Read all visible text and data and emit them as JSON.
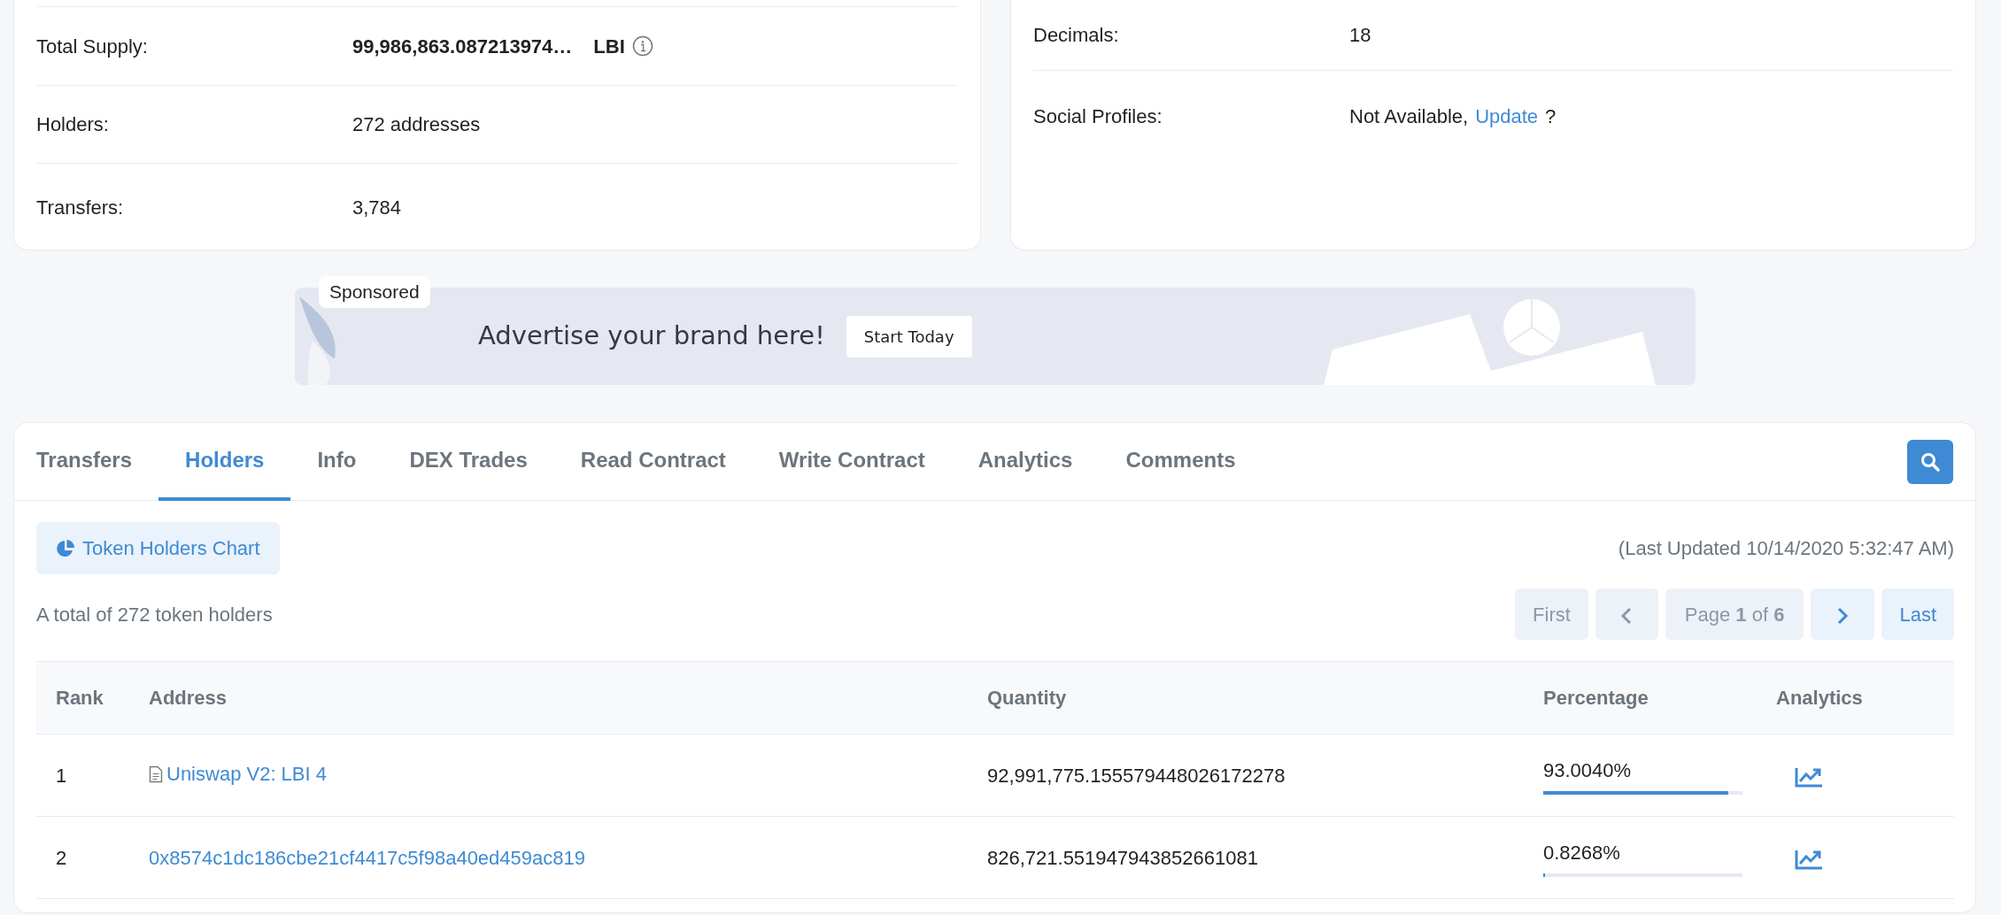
{
  "token_overview": {
    "rows": [
      {
        "label": "Total Supply:",
        "kind": "supply",
        "value": "99,986,863.087213974…",
        "unit": "LBI"
      },
      {
        "label": "Holders:",
        "kind": "text",
        "value": "272 addresses"
      },
      {
        "label": "Transfers:",
        "kind": "text",
        "value": "3,784"
      }
    ]
  },
  "profile_summary": {
    "rows": [
      {
        "label": "Decimals:",
        "kind": "text",
        "value": "18"
      },
      {
        "label": "Social Profiles:",
        "kind": "link",
        "value": "Not Available,",
        "link": "Update",
        "suffix": "?"
      }
    ]
  },
  "sponsored_banner": {
    "badge": "Sponsored",
    "headline": "Advertise your brand here!",
    "button": "Start Today"
  },
  "tabs": [
    {
      "label": "Transfers",
      "selected": false
    },
    {
      "label": "Holders",
      "selected": true
    },
    {
      "label": "Info",
      "selected": false
    },
    {
      "label": "DEX Trades",
      "selected": false
    },
    {
      "label": "Read Contract",
      "selected": false
    },
    {
      "label": "Write Contract",
      "selected": false
    },
    {
      "label": "Analytics",
      "selected": false
    },
    {
      "label": "Comments",
      "selected": false
    }
  ],
  "holders_panel": {
    "chart_button": "Token Holders Chart",
    "last_updated": "(Last Updated 10/14/2020 5:32:47 AM)",
    "total_text": "A total of 272 token holders",
    "pagination": [
      {
        "kind": "first",
        "label": "First",
        "disabled": true
      },
      {
        "kind": "prev",
        "disabled": true
      },
      {
        "kind": "page",
        "label": "Page **1** of **6**",
        "disabled": true
      },
      {
        "kind": "next",
        "disabled": false
      },
      {
        "kind": "last",
        "label": "Last",
        "disabled": false
      }
    ]
  },
  "table": {
    "columns": [
      "Rank",
      "Address",
      "Quantity",
      "Percentage",
      "Analytics"
    ],
    "rows": [
      {
        "rank": "1",
        "address": "Uniswap V2: LBI 4",
        "contract": true,
        "quantity": "92,991,775.155579448026172278",
        "percentage": "93.0040%",
        "level": 0.93004
      },
      {
        "rank": "2",
        "address": "0x8574c1dc186cbe21cf4417c5f98a40ed459ac819",
        "contract": false,
        "quantity": "826,721.551947943852661081",
        "percentage": "0.8268%",
        "level": 0.008268
      }
    ]
  }
}
